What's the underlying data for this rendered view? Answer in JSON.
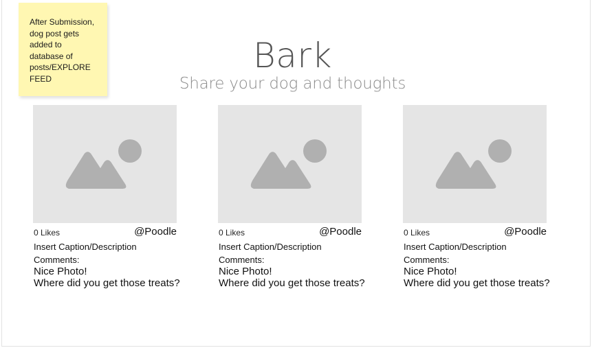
{
  "sticky_note": {
    "text": "After Submission, dog post gets added to database of posts/EXPLORE FEED"
  },
  "header": {
    "title": "Bark",
    "subtitle": "Share your dog and thoughts"
  },
  "colors": {
    "sticky": "#fff7b2",
    "placeholder_bg": "#e5e5e5",
    "placeholder_icon": "#b0b0b0"
  },
  "posts": [
    {
      "likes": "0 Likes",
      "username": "@Poodle",
      "caption": "Insert Caption/Description",
      "comments_label": "Comments:",
      "comments": [
        "Nice Photo!",
        "Where did you get those treats?"
      ],
      "image_icon": "image-placeholder-icon"
    },
    {
      "likes": "0 Likes",
      "username": "@Poodle",
      "caption": "Insert Caption/Description",
      "comments_label": "Comments:",
      "comments": [
        "Nice Photo!",
        "Where did you get those treats?"
      ],
      "image_icon": "image-placeholder-icon"
    },
    {
      "likes": "0 Likes",
      "username": "@Poodle",
      "caption": "Insert Caption/Description",
      "comments_label": "Comments:",
      "comments": [
        "Nice Photo!",
        "Where did you get those treats?"
      ],
      "image_icon": "image-placeholder-icon"
    }
  ]
}
